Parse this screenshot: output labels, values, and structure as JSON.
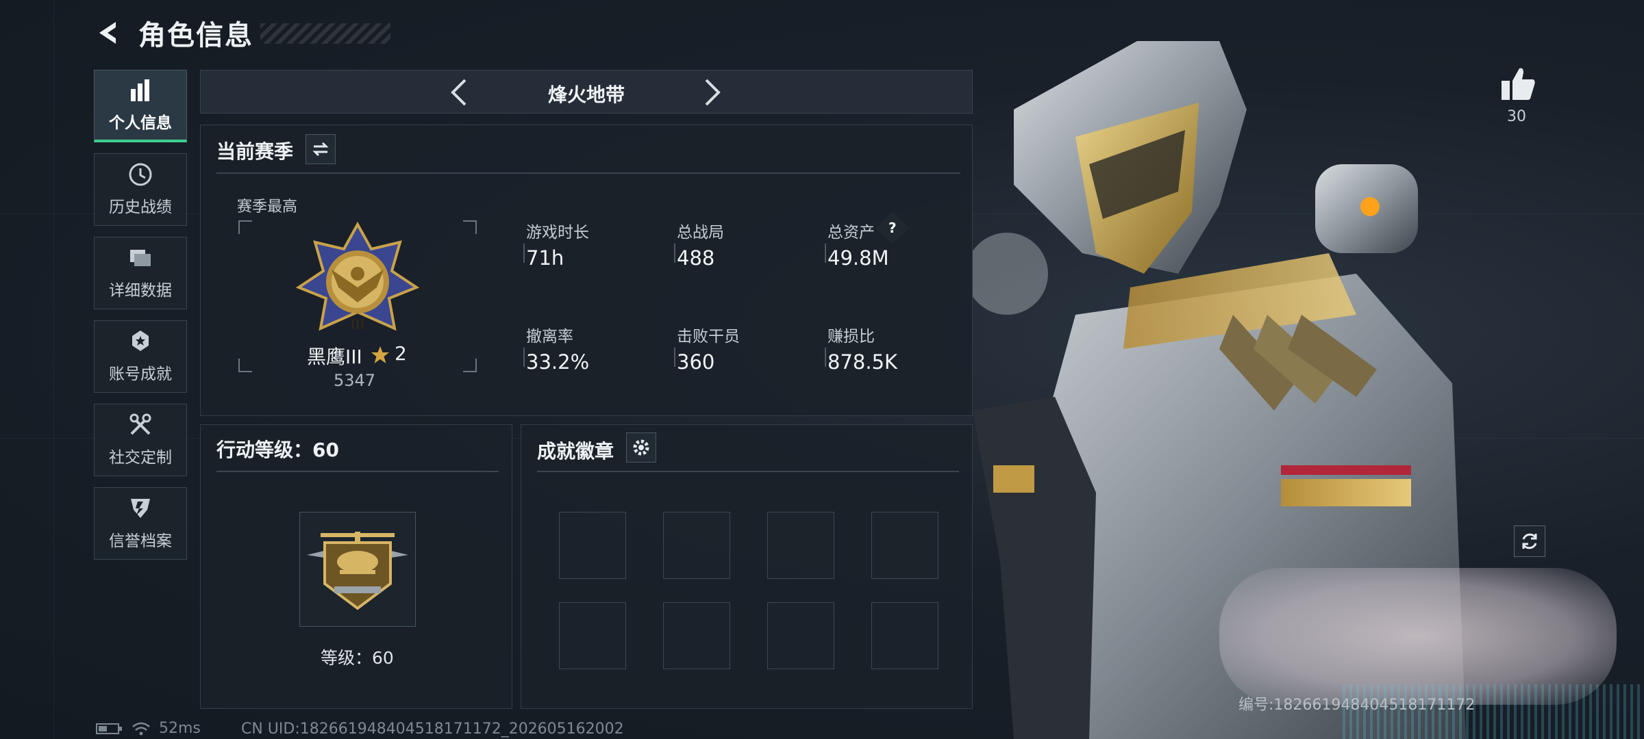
{
  "header": {
    "title": "角色信息"
  },
  "sidebar": {
    "items": [
      {
        "label": "个人信息",
        "icon": "bar-chart-icon",
        "active": true
      },
      {
        "label": "历史战绩",
        "icon": "clock-icon",
        "active": false
      },
      {
        "label": "详细数据",
        "icon": "folder-icon",
        "active": false
      },
      {
        "label": "账号成就",
        "icon": "trophy-icon",
        "active": false
      },
      {
        "label": "社交定制",
        "icon": "tools-icon",
        "active": false
      },
      {
        "label": "信誉档案",
        "icon": "emblem-icon",
        "active": false
      }
    ]
  },
  "mode": {
    "name": "烽火地带"
  },
  "season": {
    "title": "当前赛季",
    "best_label": "赛季最高",
    "rank_name": "黑鹰III",
    "rank_stars": "2",
    "rank_score": "5347",
    "stats": [
      {
        "label": "游戏时长",
        "value": "71h"
      },
      {
        "label": "总战局",
        "value": "488"
      },
      {
        "label": "总资产",
        "value": "49.8M",
        "help": "?"
      },
      {
        "label": "撤离率",
        "value": "33.2%"
      },
      {
        "label": "击败干员",
        "value": "360"
      },
      {
        "label": "赚损比",
        "value": "878.5K"
      }
    ]
  },
  "action_level": {
    "title": "行动等级：60",
    "level_text": "等级：60"
  },
  "achievements": {
    "title": "成就徽章"
  },
  "likes": {
    "count": "30"
  },
  "character": {
    "uid_label": "编号:1826619484045181711​72"
  },
  "status_bar": {
    "ping": "52ms",
    "uid": "CN UID:1826619484045181711​72_202605162002"
  },
  "colors": {
    "accent": "#3ecf8e",
    "gold": "#c9a24a",
    "background": "#161c24"
  }
}
